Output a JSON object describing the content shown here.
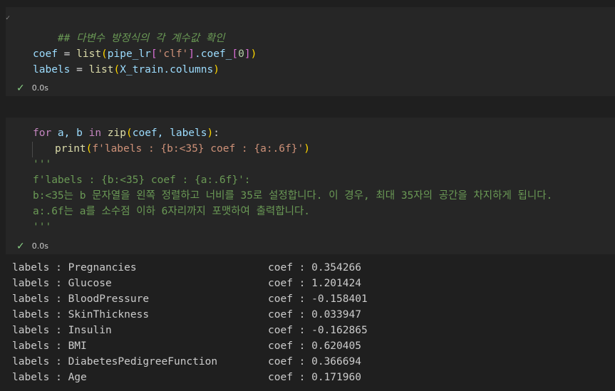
{
  "cell1": {
    "comment": "## 다변수 방정식의 각 계수값 확인",
    "line1": {
      "var": "coef",
      "eq": " = ",
      "fn": "list",
      "open": "(",
      "arg": "pipe_lr",
      "idx_open": "[",
      "key": "'clf'",
      "idx_close": "]",
      "attr": ".coef_",
      "idx2_open": "[",
      "zero": "0",
      "idx2_close": "]",
      "close": ")"
    },
    "line2": {
      "var": "labels",
      "eq": " = ",
      "fn": "list",
      "open": "(",
      "arg": "X_train.columns",
      "close": ")"
    },
    "status_time": "0.0s"
  },
  "cell2": {
    "line1": {
      "kw_for": "for",
      "vars": " a, b ",
      "kw_in": "in",
      "sp": " ",
      "fn": "zip",
      "open": "(",
      "args": "coef, labels",
      "close": ")",
      "colon": ":"
    },
    "line2": {
      "fn": "print",
      "open": "(",
      "str": "f'labels : {b:<35} coef : {a:.6f}'",
      "close": ")"
    },
    "doc_lines": [
      "'''",
      "f'labels : {b:<35} coef : {a:.6f}':",
      "b:<35는 b 문자열을 왼쪽 정렬하고 너비를 35로 설정합니다. 이 경우, 최대 35자의 공간을 차지하게 됩니다.",
      "a:.6f는 a를 소수점 이하 6자리까지 포맷하여 출력합니다.",
      "'''"
    ],
    "status_time": "0.0s"
  },
  "output": [
    {
      "label": "labels : Pregnancies",
      "coef": "coef : 0.354266"
    },
    {
      "label": "labels : Glucose",
      "coef": "coef : 1.201424"
    },
    {
      "label": "labels : BloodPressure",
      "coef": "coef : -0.158401"
    },
    {
      "label": "labels : SkinThickness",
      "coef": "coef : 0.033947"
    },
    {
      "label": "labels : Insulin",
      "coef": "coef : -0.162865"
    },
    {
      "label": "labels : BMI",
      "coef": "coef : 0.620405"
    },
    {
      "label": "labels : DiabetesPedigreeFunction",
      "coef": "coef : 0.366694"
    },
    {
      "label": "labels : Age",
      "coef": "coef : 0.171960"
    }
  ],
  "icons": {
    "check": "check-icon",
    "gutter": "chevron-icon"
  },
  "colors": {
    "background": "#1f1f1f",
    "cell_background": "#262626",
    "success": "#89d185"
  }
}
